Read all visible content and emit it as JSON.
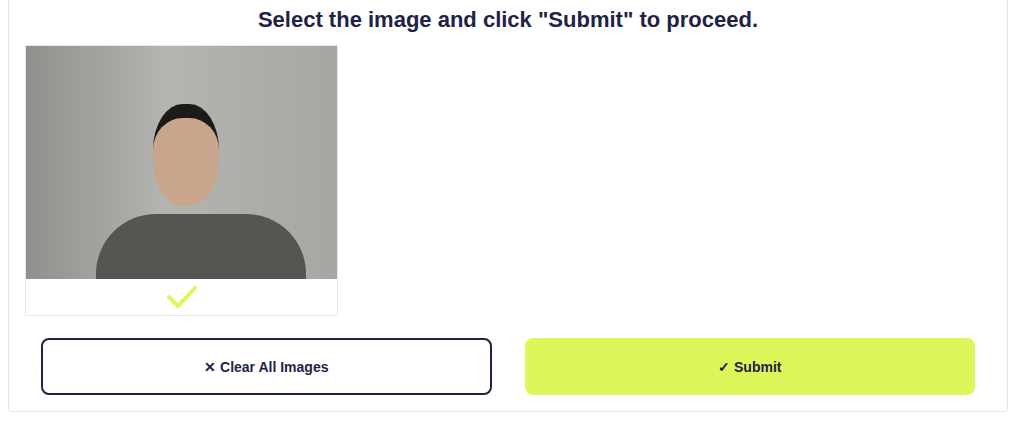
{
  "title": "Select the image and click \"Submit\" to proceed.",
  "images": [
    {
      "selected": true
    }
  ],
  "buttons": [
    {
      "icon": "✕",
      "label": "Clear All Images",
      "kind": "outline"
    },
    {
      "icon": "✓",
      "label": "Submit",
      "kind": "primary"
    }
  ]
}
